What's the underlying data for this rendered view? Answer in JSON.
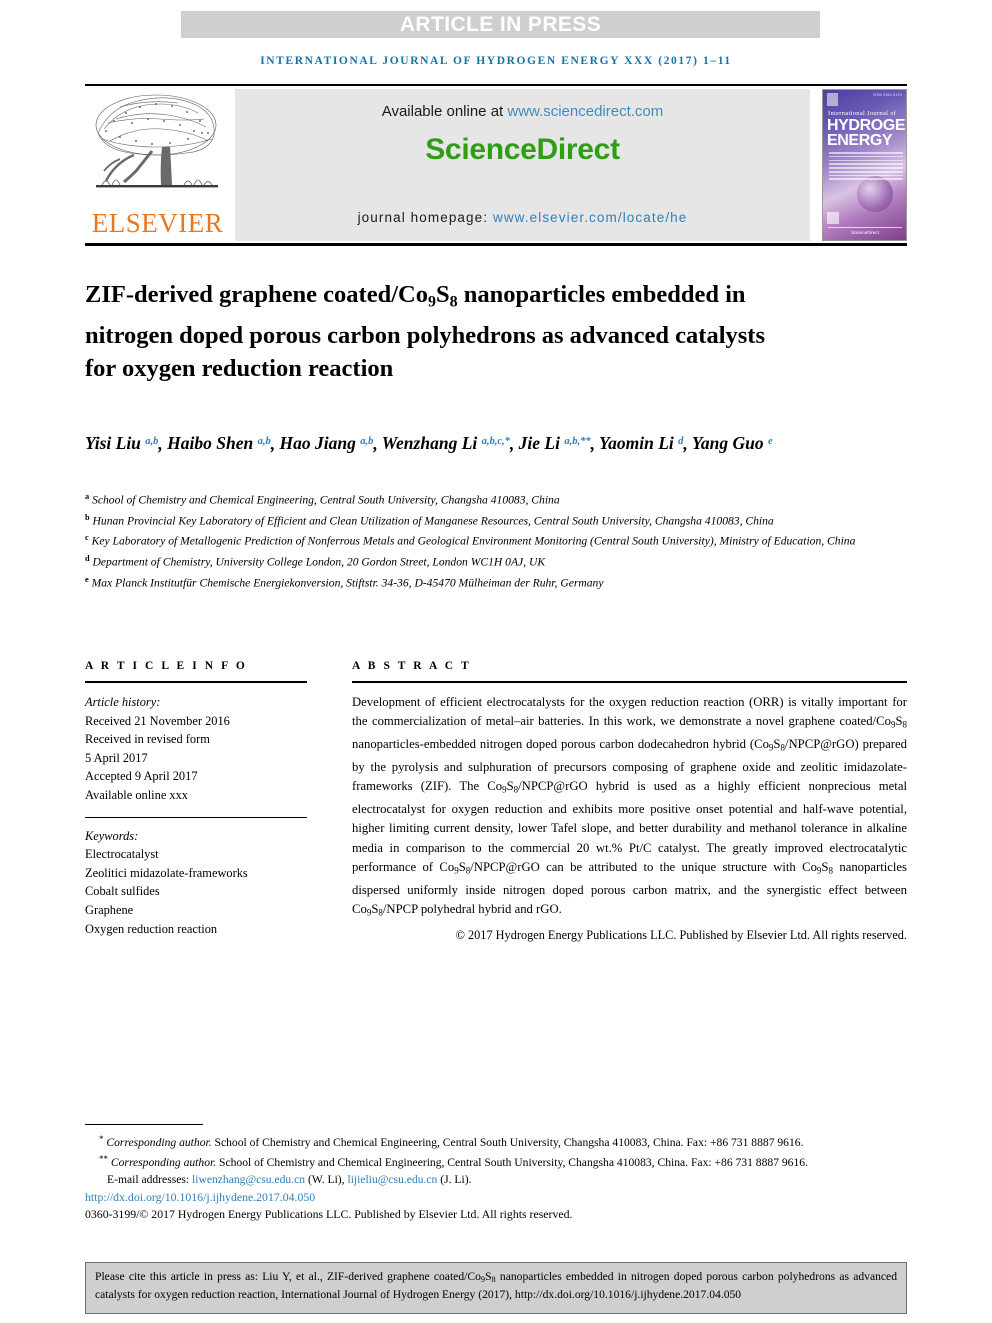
{
  "banner": {
    "text": "ARTICLE IN PRESS"
  },
  "running_head": "INTERNATIONAL JOURNAL OF HYDROGEN ENERGY XXX (2017) 1–11",
  "masthead": {
    "available_prefix": "Available online at ",
    "available_link": "www.sciencedirect.com",
    "sciencedirect_logo": "ScienceDirect",
    "homepage_prefix": "journal homepage: ",
    "homepage_link": "www.elsevier.com/locate/he",
    "publisher_wordmark": "ELSEVIER",
    "cover": {
      "line1": "International Journal of",
      "line2": "HYDROGEN",
      "line3": "ENERGY",
      "top_code": "ISSN 0360-3199",
      "footer": "ScienceDirect"
    }
  },
  "article": {
    "title_line1": "ZIF-derived graphene coated/Co",
    "title_sub1": "9",
    "title_mid1": "S",
    "title_sub2": "8",
    "title_rest": " nanoparticles embedded in nitrogen doped porous carbon polyhedrons as advanced catalysts for oxygen reduction reaction",
    "title_plain": "ZIF-derived graphene coated/Co9S8 nanoparticles embedded in nitrogen doped porous carbon polyhedrons as advanced catalysts for oxygen reduction reaction"
  },
  "authors": [
    {
      "name": "Yisi Liu",
      "marks": "a,b",
      "sep": ", "
    },
    {
      "name": "Haibo Shen",
      "marks": "a,b",
      "sep": ", "
    },
    {
      "name": "Hao Jiang",
      "marks": "a,b",
      "sep": ", "
    },
    {
      "name": "Wenzhang Li",
      "marks": "a,b,c,*",
      "sep": ", "
    },
    {
      "name": "Jie Li",
      "marks": "a,b,**",
      "sep": ", "
    },
    {
      "name": "Yaomin Li",
      "marks": "d",
      "sep": ", "
    },
    {
      "name": "Yang Guo",
      "marks": "e",
      "sep": ""
    }
  ],
  "affiliations": [
    {
      "mark": "a",
      "text": "School of Chemistry and Chemical Engineering, Central South University, Changsha 410083, China"
    },
    {
      "mark": "b",
      "text": "Hunan Provincial Key Laboratory of Efficient and Clean Utilization of Manganese Resources, Central South University, Changsha 410083, China"
    },
    {
      "mark": "c",
      "text": "Key Laboratory of Metallogenic Prediction of Nonferrous Metals and Geological Environment Monitoring (Central South University), Ministry of Education, China"
    },
    {
      "mark": "d",
      "text": "Department of Chemistry, University College London, 20 Gordon Street, London WC1H 0AJ, UK"
    },
    {
      "mark": "e",
      "text": "Max Planck Institutfür Chemische Energiekonversion, Stiftstr. 34-36, D-45470 Mülheiman der Ruhr, Germany"
    }
  ],
  "article_info": {
    "heading": "A R T I C L E   I N F O",
    "history_label": "Article history:",
    "history": [
      "Received 21 November 2016",
      "Received in revised form",
      "5 April 2017",
      "Accepted 9 April 2017",
      "Available online xxx"
    ],
    "keywords_label": "Keywords:",
    "keywords": [
      "Electrocatalyst",
      "Zeolitici midazolate-frameworks",
      "Cobalt sulfides",
      "Graphene",
      "Oxygen reduction reaction"
    ]
  },
  "abstract": {
    "heading": "A B S T R A C T",
    "paragraph": "Development of efficient electrocatalysts for the oxygen reduction reaction (ORR) is vitally important for the commercialization of metal–air batteries. In this work, we demonstrate a novel graphene coated/Co9S8 nanoparticles-embedded nitrogen doped porous carbon dodecahedron hybrid (Co9S8/NPCP@rGO) prepared by the pyrolysis and sulphuration of precursors composing of graphene oxide and zeolitic imidazolate-frameworks (ZIF). The Co9S8/NPCP@rGO hybrid is used as a highly efficient nonprecious metal electrocatalyst for oxygen reduction and exhibits more positive onset potential and half-wave potential, higher limiting current density, lower Tafel slope, and better durability and methanol tolerance in alkaline media in comparison to the commercial 20 wt.% Pt/C catalyst. The greatly improved electrocatalytic performance of Co9S8/NPCP@rGO can be attributed to the unique structure with Co9S8 nanoparticles dispersed uniformly inside nitrogen doped porous carbon matrix, and the synergistic effect between Co9S8/NPCP polyhedral hybrid and rGO.",
    "copyright": "© 2017 Hydrogen Energy Publications LLC. Published by Elsevier Ltd. All rights reserved."
  },
  "footnotes": {
    "corr1_mark": "*",
    "corr1_lead": "Corresponding author.",
    "corr1_text": " School of Chemistry and Chemical Engineering, Central South University, Changsha 410083, China. Fax: +86 731 8887 9616.",
    "corr2_mark": "**",
    "corr2_lead": "Corresponding author.",
    "corr2_text": " School of Chemistry and Chemical Engineering, Central South University, Changsha 410083, China. Fax: +86 731 8887 9616.",
    "email_label": "E-mail addresses: ",
    "email1": "liwenzhang@csu.edu.cn",
    "email1_owner": " (W. Li), ",
    "email2": "lijieliu@csu.edu.cn",
    "email2_owner": " (J. Li).",
    "doi": "http://dx.doi.org/10.1016/j.ijhydene.2017.04.050",
    "issn": "0360-3199/© 2017 Hydrogen Energy Publications LLC. Published by Elsevier Ltd. All rights reserved."
  },
  "cite_box": {
    "text_part1": "Please cite this article in press as: Liu Y, et al., ZIF-derived graphene coated/Co",
    "sub1": "9",
    "mid1": "S",
    "sub2": "8",
    "text_part2": " nanoparticles embedded in nitrogen doped porous carbon polyhedrons as advanced catalysts for oxygen reduction reaction, International Journal of Hydrogen Energy (2017), http://dx.doi.org/10.1016/j.ijhydene.2017.04.050"
  },
  "colors": {
    "banner_bg": "#cfcfcf",
    "running_head": "#1573a5",
    "sciencedirect_green": "#2f9e15",
    "link_blue": "#2b7fb8",
    "elsevier_orange": "#e87722",
    "masthead_bg": "#e6e6e6"
  }
}
